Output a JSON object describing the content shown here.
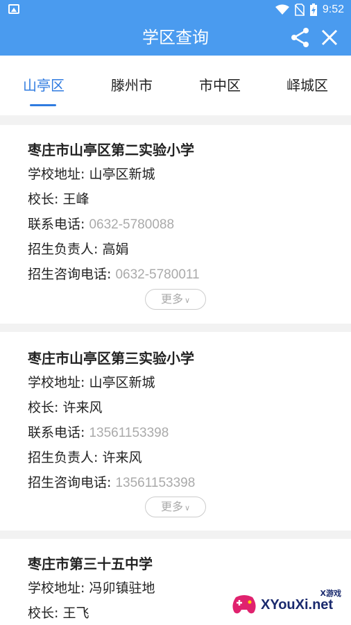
{
  "status_bar": {
    "time": "9:52"
  },
  "app_bar": {
    "title": "学区查询"
  },
  "tabs": [
    {
      "label": "山亭区",
      "active": true
    },
    {
      "label": "滕州市",
      "active": false
    },
    {
      "label": "市中区",
      "active": false
    },
    {
      "label": "峄城区",
      "active": false
    }
  ],
  "schools": [
    {
      "name": "枣庄市山亭区第二实验小学",
      "address_label": "学校地址:",
      "address": "山亭区新城",
      "principal_label": "校长:",
      "principal": "王峰",
      "phone_label": "联系电话:",
      "phone": "0632-5780088",
      "admission_label": "招生负责人:",
      "admission_person": "高娟",
      "consult_label": "招生咨询电话:",
      "consult_phone": "0632-5780011",
      "more": "更多"
    },
    {
      "name": "枣庄市山亭区第三实验小学",
      "address_label": "学校地址:",
      "address": "山亭区新城",
      "principal_label": "校长:",
      "principal": "许来风",
      "phone_label": "联系电话:",
      "phone": "13561153398",
      "admission_label": "招生负责人:",
      "admission_person": "许来风",
      "consult_label": "招生咨询电话:",
      "consult_phone": "13561153398",
      "more": "更多"
    },
    {
      "name": "枣庄市第三十五中学",
      "address_label": "学校地址:",
      "address": "冯卯镇驻地",
      "principal_label": "校长:",
      "principal": "王飞"
    }
  ],
  "watermark": {
    "text": "XYouXi.net",
    "small": "X游戏"
  },
  "colors": {
    "primary": "#4a9bef",
    "accent": "#2f7be0",
    "muted": "#aaaaaa"
  }
}
